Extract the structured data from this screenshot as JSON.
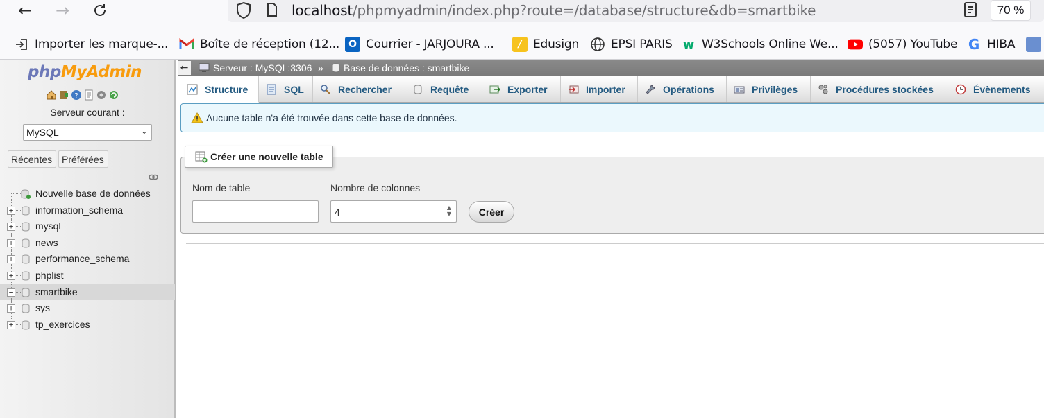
{
  "browser": {
    "url_host": "localhost",
    "url_path": "/phpmyadmin/index.php?route=/database/structure&db=smartbike",
    "zoom": "70 %",
    "bookmarks": [
      {
        "label": "Importer les marque-...",
        "icon": "import-icon"
      },
      {
        "label": "Boîte de réception (12...",
        "icon": "gmail-icon"
      },
      {
        "label": "Courrier - JARJOURA ...",
        "icon": "outlook-icon"
      },
      {
        "label": "Edusign",
        "icon": "edusign-icon"
      },
      {
        "label": "EPSI PARIS",
        "icon": "globe-icon"
      },
      {
        "label": "W3Schools Online We...",
        "icon": "w3schools-icon"
      },
      {
        "label": "(5057) YouTube",
        "icon": "youtube-icon"
      },
      {
        "label": "HIBA",
        "icon": "google-icon"
      }
    ]
  },
  "sidebar": {
    "logo_php": "php",
    "logo_myadmin": "MyAdmin",
    "server_label": "Serveur courant :",
    "server_value": "MySQL",
    "tab_recent": "Récentes",
    "tab_favorites": "Préférées",
    "new_db": "Nouvelle base de données",
    "databases": [
      "information_schema",
      "mysql",
      "news",
      "performance_schema",
      "phplist",
      "smartbike",
      "sys",
      "tp_exercices"
    ],
    "active_db": "smartbike"
  },
  "breadcrumb": {
    "server": "Serveur : MySQL:3306",
    "separator": "»",
    "database": "Base de données : smartbike"
  },
  "tabs": [
    {
      "label": "Structure",
      "icon": "structure-icon"
    },
    {
      "label": "SQL",
      "icon": "sql-icon"
    },
    {
      "label": "Rechercher",
      "icon": "search-icon"
    },
    {
      "label": "Requête",
      "icon": "query-icon"
    },
    {
      "label": "Exporter",
      "icon": "export-icon"
    },
    {
      "label": "Importer",
      "icon": "import-icon"
    },
    {
      "label": "Opérations",
      "icon": "wrench-icon"
    },
    {
      "label": "Privilèges",
      "icon": "privileges-icon"
    },
    {
      "label": "Procédures stockées",
      "icon": "routines-icon"
    },
    {
      "label": "Évènements",
      "icon": "events-icon"
    }
  ],
  "notice": "Aucune table n'a été trouvée dans cette base de données.",
  "create_table": {
    "legend": "Créer une nouvelle table",
    "name_label": "Nom de table",
    "name_value": "",
    "columns_label": "Nombre de colonnes",
    "columns_value": "4",
    "button": "Créer"
  }
}
